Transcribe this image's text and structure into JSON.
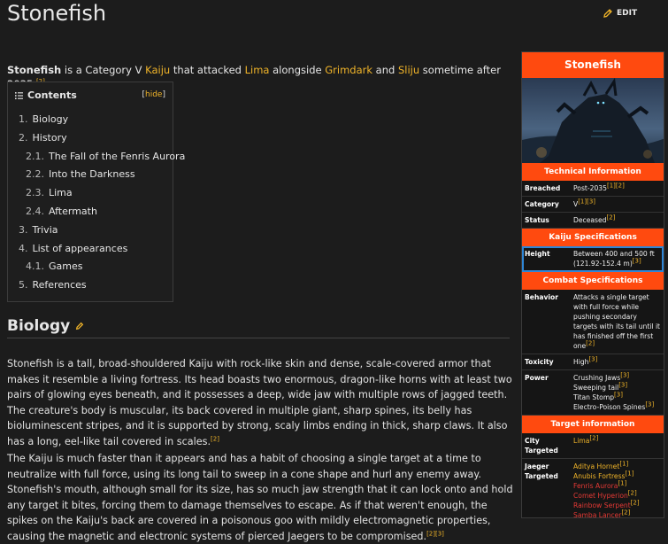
{
  "page": {
    "title": "Stonefish",
    "edit_label": "EDIT"
  },
  "intro": {
    "subject": "Stonefish",
    "t1": " is a Category V ",
    "link_kaiju": "Kaiju",
    "t2": " that attacked ",
    "link_lima": "Lima",
    "t3": " alongside ",
    "link_grimdark": "Grimdark",
    "t4": " and ",
    "link_sliju": "Sliju",
    "t5": " sometime after 2035.",
    "ref": "[2]"
  },
  "toc": {
    "title": "Contents",
    "hide_label": "hide",
    "items": [
      {
        "num": "1.",
        "label": "Biology",
        "level": 1
      },
      {
        "num": "2.",
        "label": "History",
        "level": 1
      },
      {
        "num": "2.1.",
        "label": "The Fall of the Fenris Aurora",
        "level": 2
      },
      {
        "num": "2.2.",
        "label": "Into the Darkness",
        "level": 2
      },
      {
        "num": "2.3.",
        "label": "Lima",
        "level": 2
      },
      {
        "num": "2.4.",
        "label": "Aftermath",
        "level": 2
      },
      {
        "num": "3.",
        "label": "Trivia",
        "level": 1
      },
      {
        "num": "4.",
        "label": "List of appearances",
        "level": 1
      },
      {
        "num": "4.1.",
        "label": "Games",
        "level": 2
      },
      {
        "num": "5.",
        "label": "References",
        "level": 1
      }
    ]
  },
  "biology": {
    "heading": "Biology",
    "para1": "Stonefish is a tall, broad-shouldered Kaiju with rock-like skin and dense, scale-covered armor that makes it resemble a living fortress. Its head boasts two enormous, dragon-like horns with at least two pairs of glowing eyes beneath, and it possesses a deep, wide jaw with multiple rows of jagged teeth. The creature's body is muscular, its back covered in multiple giant, sharp spines, its belly has bioluminescent stripes, and it is supported by strong, scaly limbs ending in thick, sharp claws. It also has a long, eel-like tail covered in scales.",
    "para1_ref": "[2]",
    "para2": "The Kaiju is much faster than it appears and has a habit of choosing a single target at a time to neutralize with full force, using its long tail to sweep in a cone shape and hurl any enemy away. Stonefish's mouth, although small for its size, has so much jaw strength that it can lock onto and hold any target it bites, forcing them to damage themselves to escape. As if that weren't enough, the spikes on the Kaiju's back are covered in a poisonous goo with mildly electromagnetic properties, causing the magnetic and electronic systems of pierced Jaegers to be compromised.",
    "para2_ref": "[2][3]"
  },
  "infobox": {
    "title": "Stonefish",
    "sections": {
      "technical": "Technical Information",
      "kaiju_specs": "Kaiju Specifications",
      "combat_specs": "Combat Specifications",
      "target": "Target information"
    },
    "breached": {
      "label": "Breached",
      "value": "Post-2035",
      "ref": "[1][2]"
    },
    "category": {
      "label": "Category",
      "value": "V",
      "ref": "[1][3]"
    },
    "status": {
      "label": "Status",
      "value": "Deceased",
      "ref": "[2]"
    },
    "height": {
      "label": "Height",
      "value": "Between 400 and 500 ft (121.92-152.4 m)",
      "ref": "[3]"
    },
    "behavior": {
      "label": "Behavior",
      "value": "Attacks a single target with full force while pushing secondary targets with its tail until it has finished off the first one",
      "ref": "[2]"
    },
    "toxicity": {
      "label": "Toxicity",
      "value": "High",
      "ref": "[3]"
    },
    "power": {
      "label": "Power",
      "items": [
        {
          "name": "Crushing Jaws",
          "ref": "[3]"
        },
        {
          "name": "Sweeping tail",
          "ref": "[3]"
        },
        {
          "name": "Titan Stomp",
          "ref": "[3]"
        },
        {
          "name": "Electro-Poison Spines",
          "ref": "[3]"
        }
      ]
    },
    "city_targeted": {
      "label": "City Targeted",
      "value": "Lima",
      "ref": "[2]"
    },
    "jaeger_targeted": {
      "label": "Jaeger Targeted",
      "items": [
        {
          "name": "Aditya Hornet",
          "ref": "[1]",
          "color": "#f0b429"
        },
        {
          "name": "Anubis Fortress",
          "ref": "[1]",
          "color": "#f0b429"
        },
        {
          "name": "Fenris Aurora",
          "ref": "[1]",
          "color": "#e53935"
        },
        {
          "name": "Comet Hyperion",
          "ref": "[2]",
          "color": "#e53935"
        },
        {
          "name": "Rainbow Serpent",
          "ref": "[2]",
          "color": "#e53935"
        },
        {
          "name": "Samba Lancer",
          "ref": "[2]",
          "color": "#e53935"
        }
      ]
    }
  },
  "colors": {
    "accent": "#ff4a0f",
    "link": "#f0b429",
    "redlink": "#e53935",
    "selection": "#2f86d6"
  }
}
